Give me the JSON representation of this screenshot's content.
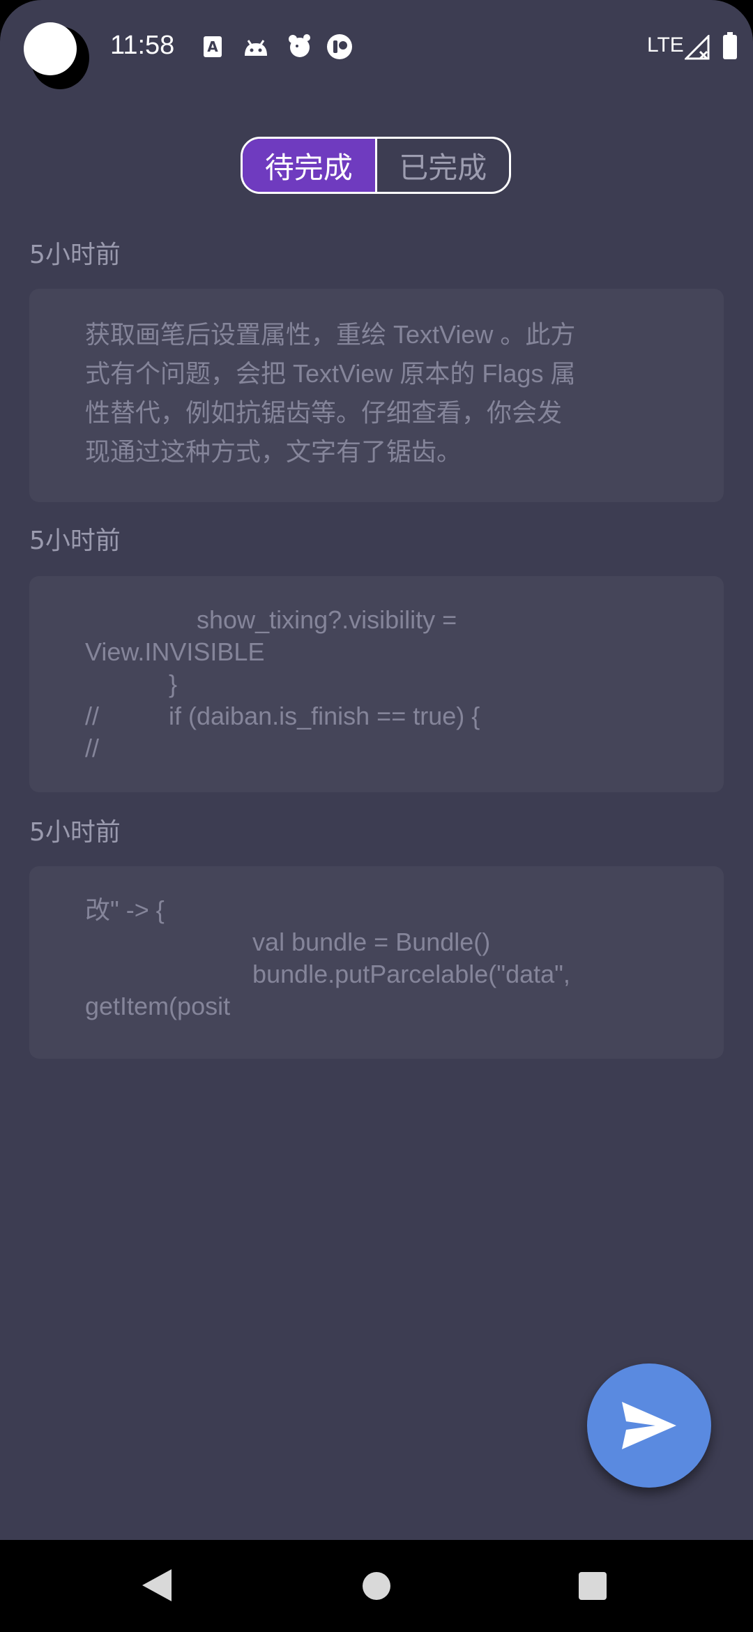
{
  "status_bar": {
    "time": "11:58",
    "network": "LTE",
    "icons": [
      "font-accessibility-icon",
      "android-icon",
      "pet-icon",
      "app-badge-icon",
      "signal-icon",
      "battery-icon"
    ]
  },
  "tabs": [
    {
      "label": "待完成",
      "active": true
    },
    {
      "label": "已完成",
      "active": false
    }
  ],
  "notes": [
    {
      "time": "5小时前",
      "content": "获取画笔后设置属性，重绘 TextView 。此方\n式有个问题，会把 TextView 原本的 Flags 属\n性替代，例如抗锯齿等。仔细查看，你会发\n现通过这种方式，文字有了锯齿。"
    },
    {
      "time": "5小时前",
      "content": "                show_tixing?.visibility =\nView.INVISIBLE\n            }\n//          if (daiban.is_finish == true) {\n//"
    },
    {
      "time": "5小时前",
      "content": "改\" -> {\n                        val bundle = Bundle()\n                        bundle.putParcelable(\"data\",\ngetItem(posit"
    }
  ],
  "fab": {
    "icon": "send-icon"
  },
  "colors": {
    "background": "#3d3d52",
    "card": "#454559",
    "tab_active": "#6f3bbf",
    "fab": "#5a8ae0"
  }
}
